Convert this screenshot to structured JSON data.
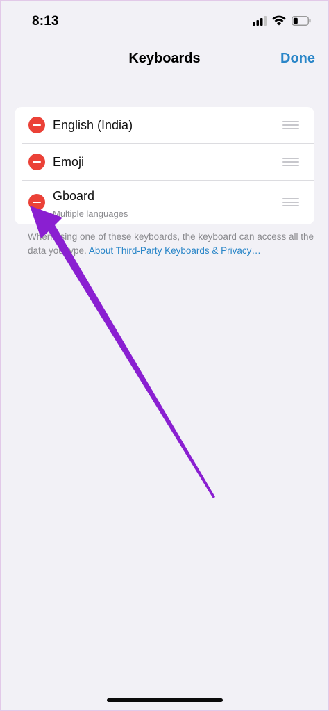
{
  "status_bar": {
    "time": "8:13",
    "icons": [
      "signal-icon",
      "wifi-icon",
      "battery-icon"
    ]
  },
  "nav": {
    "title": "Keyboards",
    "done_label": "Done"
  },
  "keyboards": [
    {
      "label": "English (India)",
      "sub": ""
    },
    {
      "label": "Emoji",
      "sub": ""
    },
    {
      "label": "Gboard",
      "sub": "Multiple languages"
    }
  ],
  "footer": {
    "text": "When using one of these keyboards, the keyboard can access all the data you type.",
    "link": "About Third-Party Keyboards & Privacy…"
  },
  "colors": {
    "accent": "#2a86c8",
    "delete": "#eb4137",
    "annotation_arrow": "#8a1fd1",
    "background": "#f2f1f6"
  }
}
